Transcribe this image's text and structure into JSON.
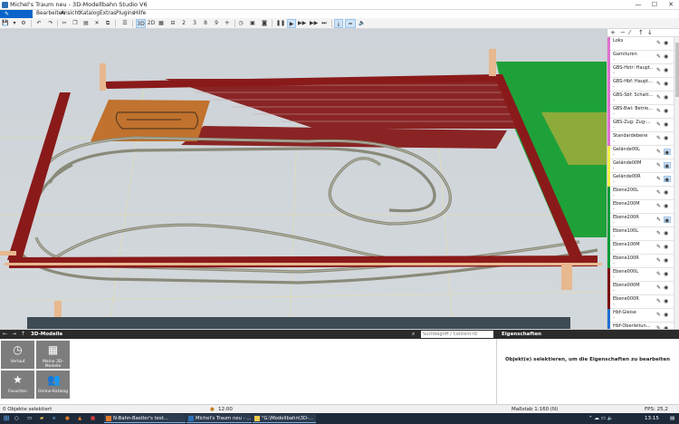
{
  "window": {
    "title": "Michel's Traum neu - 3D-Modellbahn Studio V6",
    "minimize": "—",
    "maximize": "☐",
    "close": "✕"
  },
  "menu": {
    "file_icon": "pencil-icon",
    "items": [
      "Bearbeiten",
      "Ansicht",
      "Katalog",
      "Extras",
      "Plugins",
      "Hilfe"
    ]
  },
  "toolbar": {
    "view_3d": "3D",
    "view_2d": "2D",
    "nums": [
      "2",
      "3",
      "8",
      "9"
    ]
  },
  "layers": [
    {
      "name": "Loks",
      "color": "#e070d0",
      "extra": ""
    },
    {
      "name": "Garnituren",
      "color": "#e070d0",
      "extra": "-"
    },
    {
      "name": "GBS-Hstr: Haupt...",
      "color": "#e070d0",
      "extra": "-"
    },
    {
      "name": "GBS-Hbf: Haupt...",
      "color": "#e070d0",
      "extra": "-"
    },
    {
      "name": "GBS-Sbf: Schatt...",
      "color": "#e070d0",
      "extra": "-"
    },
    {
      "name": "GBS-Bwl: Betrie...",
      "color": "#e070d0",
      "extra": "-"
    },
    {
      "name": "GBS-Zug: Zug-...",
      "color": "#e070d0",
      "extra": "-"
    },
    {
      "name": "Standardebene",
      "color": "#e070d0",
      "extra": "-"
    },
    {
      "name": "Gelände00L",
      "color": "#f2f04a",
      "extra": "-"
    },
    {
      "name": "Gelände00M",
      "color": "#f2f04a",
      "extra": "-"
    },
    {
      "name": "Gelände00R",
      "color": "#f2f04a",
      "extra": "-"
    },
    {
      "name": "Ebene200L",
      "color": "#0a9a3a",
      "extra": "-"
    },
    {
      "name": "Ebene200M",
      "color": "#0a9a3a",
      "extra": "-"
    },
    {
      "name": "Ebene200R",
      "color": "#0a9a3a",
      "extra": "-"
    },
    {
      "name": "Ebene100L",
      "color": "#0a9a3a",
      "extra": "-"
    },
    {
      "name": "Ebene100M",
      "color": "#0a9a3a",
      "extra": "-"
    },
    {
      "name": "Ebene100R",
      "color": "#0a9a3a",
      "extra": "-"
    },
    {
      "name": "Ebene000L",
      "color": "#7a1010",
      "extra": "-"
    },
    {
      "name": "Ebene000M",
      "color": "#7a1010",
      "extra": "-"
    },
    {
      "name": "Ebene000R",
      "color": "#7a1010",
      "extra": "-"
    },
    {
      "name": "Hbf-Gleise",
      "color": "#1e6fd0",
      "extra": "-"
    },
    {
      "name": "Hbf-Oberleitun...",
      "color": "#1e6fd0",
      "extra": "-"
    }
  ],
  "bottom": {
    "panel_title": "3D-Modelle",
    "search_placeholder": "Suchbegriff / Content-ID",
    "properties_title": "Eigenschaften",
    "properties_hint": "Objekt(e) selektieren, um die Eigenschaften zu bearbeiten",
    "tiles": [
      {
        "label": "Verlauf",
        "icon": "clock-icon"
      },
      {
        "label": "Meine 3D-Modelle",
        "icon": "grid-icon"
      },
      {
        "label": "Favoriten",
        "icon": "star-icon"
      },
      {
        "label": "Online-Katalog",
        "icon": "users-icon"
      }
    ]
  },
  "status": {
    "selection": "0 Objekte selektiert",
    "time": "12:00",
    "scale": "Maßstab 1:160 (N)",
    "fps": "FPS: 25,2"
  },
  "taskbar": {
    "tasks": [
      "N-Bahn-Bastler's test...",
      "Michel's Traum neu - ...",
      "\"G:\\Modellbahn\\3D-..."
    ],
    "clock": "13:15"
  }
}
